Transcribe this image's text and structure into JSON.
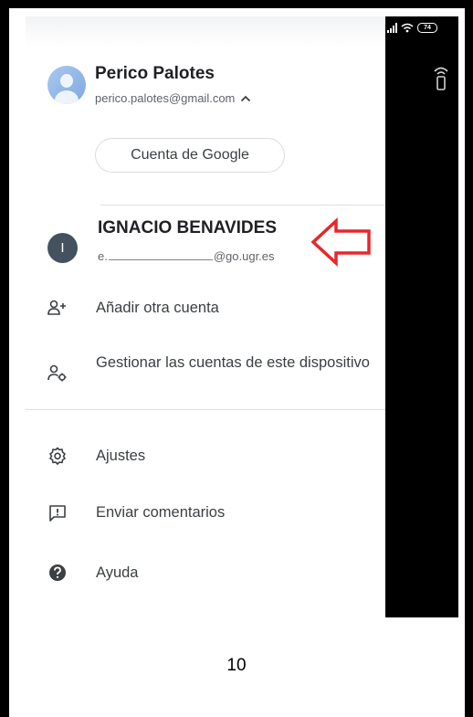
{
  "status_bar": {
    "battery": "74"
  },
  "primary_account": {
    "name": "Perico Palotes",
    "email": "perico.palotes@gmail.com",
    "manage_button": "Cuenta de Google"
  },
  "secondary_account": {
    "initial": "I",
    "name": "IGNACIO BENAVIDES",
    "email_prefix": "e.",
    "email_domain": "@go.ugr.es"
  },
  "menu": {
    "add_account": "Añadir otra cuenta",
    "manage_accounts": "Gestionar las cuentas de este dispositivo",
    "settings": "Ajustes",
    "feedback": "Enviar comentarios",
    "help": "Ayuda"
  },
  "page": {
    "number": "10"
  },
  "colors": {
    "annotation_arrow": "#e8262b",
    "secondary_avatar": "#44525f",
    "text_primary": "#202124",
    "text_secondary": "#5f6368"
  },
  "icons": {
    "signal": "signal-icon",
    "wifi": "wifi-icon",
    "battery": "battery-icon",
    "cast": "cast-icon",
    "chevron": "chevron-up-icon",
    "add_account": "person-add-icon",
    "manage_accounts": "manage-accounts-icon",
    "settings": "gear-icon",
    "feedback": "feedback-icon",
    "help": "help-icon"
  }
}
